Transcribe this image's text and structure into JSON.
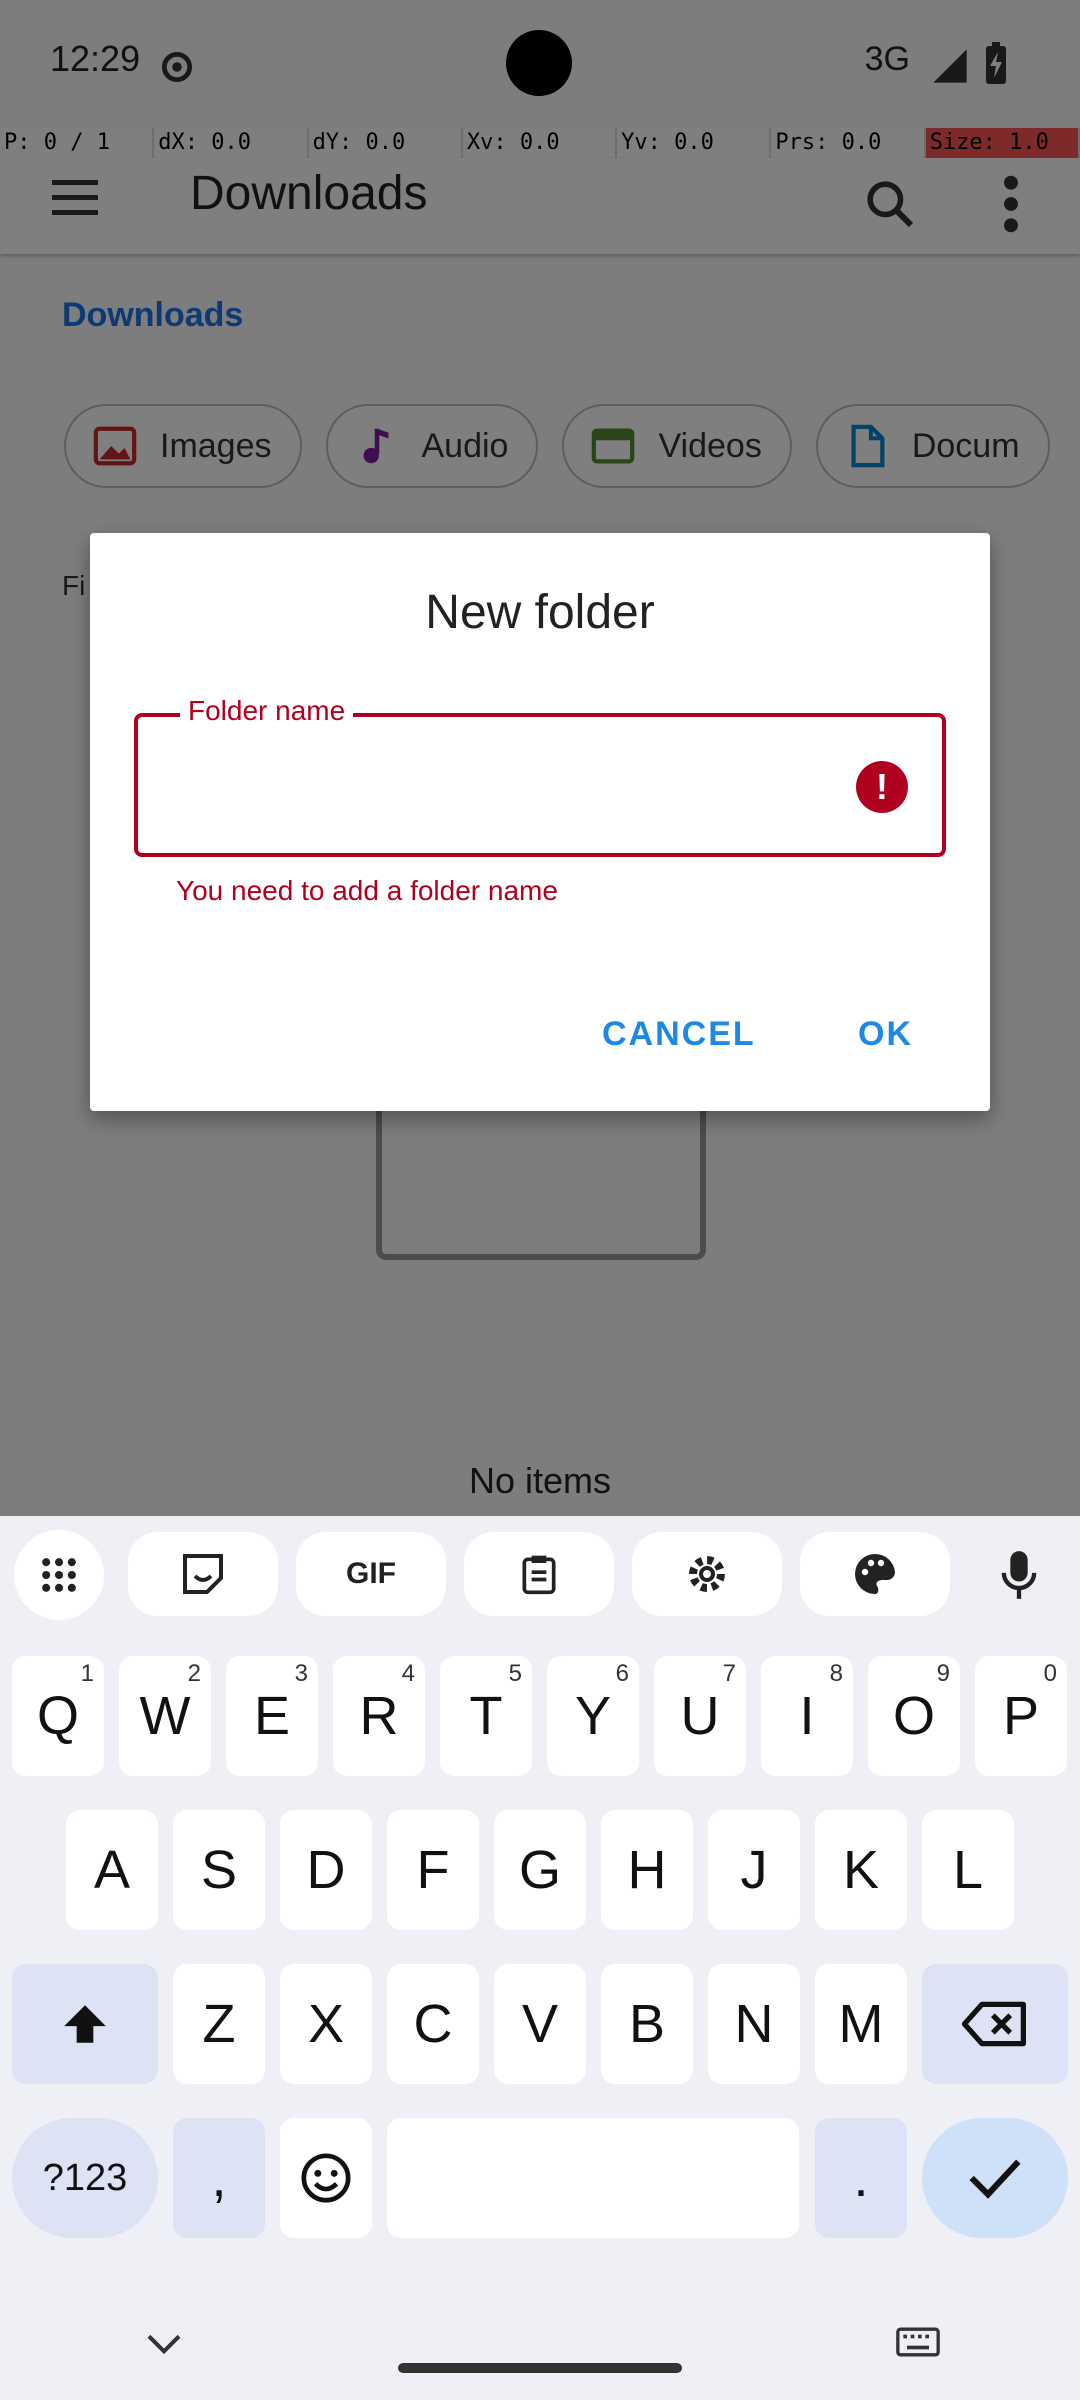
{
  "status_bar": {
    "time": "12:29",
    "network": "3G"
  },
  "pointer_info": [
    "P: 0 / 1",
    "dX: 0.0",
    "dY: 0.0",
    "Xv: 0.0",
    "Yv: 0.0",
    "Prs: 0.0",
    "Size: 1.0"
  ],
  "toolbar": {
    "title": "Downloads"
  },
  "breadcrumb": "Downloads",
  "chips": [
    {
      "label": "Images",
      "icon": "image-icon",
      "color": "#c62828"
    },
    {
      "label": "Audio",
      "icon": "music-note-icon",
      "color": "#7b1fa2"
    },
    {
      "label": "Videos",
      "icon": "video-icon",
      "color": "#558b2f"
    },
    {
      "label": "Docum",
      "icon": "document-icon",
      "color": "#0288d1"
    }
  ],
  "files_label": "Fi",
  "empty_text": "No items",
  "dialog": {
    "title": "New folder",
    "field_label": "Folder name",
    "field_value": "",
    "error": "You need to add a folder name",
    "cancel": "CANCEL",
    "ok": "OK",
    "error_color": "#b00020",
    "accent_color": "#1e88e5"
  },
  "keyboard": {
    "toolbar": [
      "apps-grid-icon",
      "sticker-icon",
      "GIF",
      "clipboard-icon",
      "settings-icon",
      "palette-icon",
      "mic-icon"
    ],
    "row1": [
      {
        "k": "Q",
        "n": "1"
      },
      {
        "k": "W",
        "n": "2"
      },
      {
        "k": "E",
        "n": "3"
      },
      {
        "k": "R",
        "n": "4"
      },
      {
        "k": "T",
        "n": "5"
      },
      {
        "k": "Y",
        "n": "6"
      },
      {
        "k": "U",
        "n": "7"
      },
      {
        "k": "I",
        "n": "8"
      },
      {
        "k": "O",
        "n": "9"
      },
      {
        "k": "P",
        "n": "0"
      }
    ],
    "row2": [
      "A",
      "S",
      "D",
      "F",
      "G",
      "H",
      "J",
      "K",
      "L"
    ],
    "row3": [
      "Z",
      "X",
      "C",
      "V",
      "B",
      "N",
      "M"
    ],
    "sym_label": "?123",
    "comma": ",",
    "period": "."
  }
}
